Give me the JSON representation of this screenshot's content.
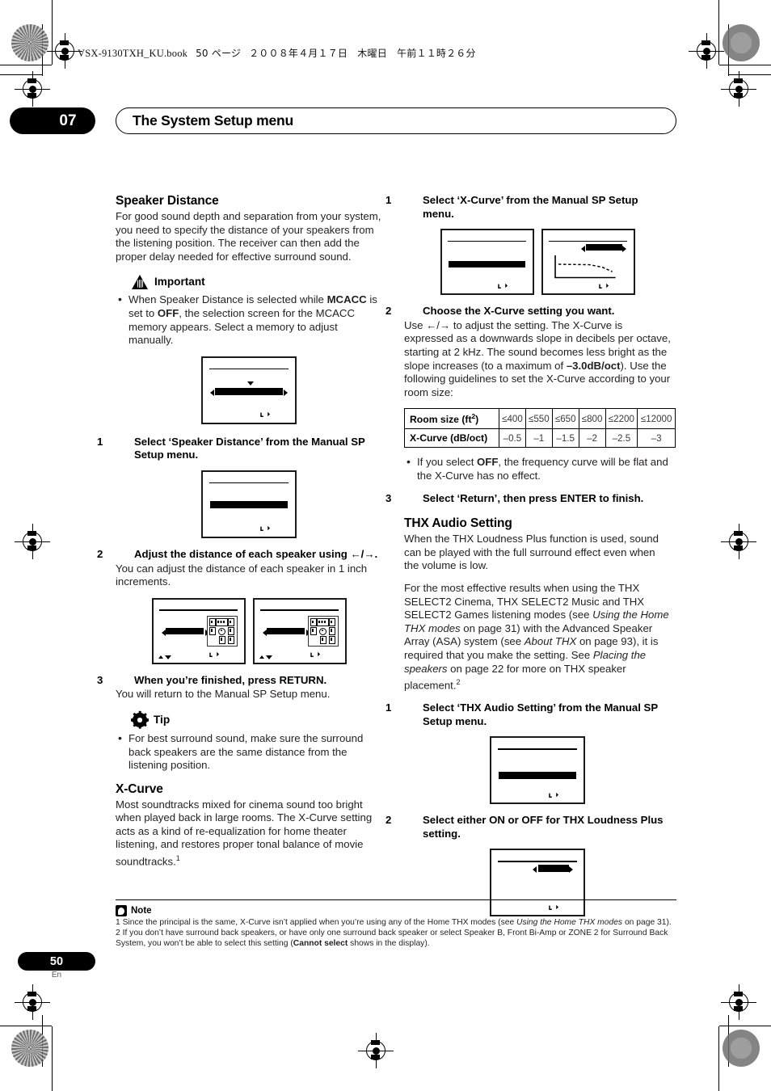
{
  "print_header": {
    "book_file": "VSX-9130TXH_KU.book",
    "page_marker": "50 ページ",
    "date": "２００８年４月１７日　木曜日　午前１１時２６分"
  },
  "chapter": {
    "number": "07",
    "title": "The System Setup menu"
  },
  "left_column": {
    "section1": {
      "heading": "Speaker Distance",
      "intro": "For good sound depth and separation from your system, you need to specify the distance of your speakers from the listening position. The receiver can then add the proper delay needed for effective surround sound.",
      "important_label": "Important",
      "important_bullet": "When Speaker Distance is selected while MCACC is set to OFF, the selection screen for the MCACC memory appears. Select a memory to adjust manually.",
      "step1_num": "1",
      "step1_text": "Select ‘Speaker Distance’ from the Manual SP Setup menu.",
      "step2_num": "2",
      "step2_text": "Adjust the distance of each speaker using ←/→.",
      "step2_body": "You can adjust the distance of each speaker in 1 inch increments.",
      "step3_num": "3",
      "step3_text": "When you’re finished, press RETURN.",
      "step3_body": "You will return to the Manual SP Setup menu.",
      "tip_label": "Tip",
      "tip_bullet": "For best surround sound, make sure the surround back speakers are the same distance from the listening position."
    },
    "section2": {
      "heading": "X-Curve",
      "body": "Most soundtracks mixed for cinema sound too bright when played back in large rooms. The X-Curve setting acts as a kind of re-equalization for home theater listening, and restores proper tonal balance of movie soundtracks.",
      "footnote_ref": "1"
    }
  },
  "right_column": {
    "xcurve_steps": {
      "step1_num": "1",
      "step1_text": "Select ‘X-Curve’ from the Manual SP Setup menu.",
      "step2_num": "2",
      "step2_text": "Choose the X-Curve setting you want.",
      "step2_body_a": "Use ←/→ to adjust the setting. The X-Curve is expressed as a downwards slope in decibels per octave, starting at 2 kHz. The sound becomes less bright as the slope increases (to a maximum of ",
      "step2_body_bold": "–3.0dB/oct",
      "step2_body_b": "). Use the following guidelines to set the X-Curve according to your room size:",
      "bullet_off": "If you select OFF, the frequency curve will be flat and the X-Curve has no effect.",
      "step3_num": "3",
      "step3_text": "Select ‘Return’, then press ENTER to finish."
    },
    "room_table": {
      "row_labels": [
        "Room size (ft2)",
        "X-Curve (dB/oct)"
      ],
      "room_sizes": [
        "≤400",
        "≤550",
        "≤650",
        "≤800",
        "≤2200",
        "≤12000"
      ],
      "xcurve_values": [
        "–0.5",
        "–1",
        "–1.5",
        "–2",
        "–2.5",
        "–3"
      ]
    },
    "thx": {
      "heading": "THX Audio Setting",
      "para1": "When the THX Loudness Plus function is used, sound can be played with the full surround effect even when the volume is low.",
      "para2_a": "For the most effective results when using the THX SELECT2 Cinema, THX SELECT2 Music and THX SELECT2 Games listening modes (see ",
      "para2_i1": "Using the Home THX modes",
      "para2_b": " on page 31) with the Advanced Speaker Array (ASA) system (see ",
      "para2_i2": "About THX",
      "para2_c": " on page 93), it is required that you make the setting. See ",
      "para2_i3": "Placing the speakers",
      "para2_d": " on page 22 for more on THX speaker placement.",
      "para2_ref": "2",
      "step1_num": "1",
      "step1_text": "Select ‘THX Audio Setting’ from the Manual SP Setup menu.",
      "step2_num": "2",
      "step2_text": "Select either ON or OFF for THX Loudness Plus setting."
    }
  },
  "notes": {
    "label": "Note",
    "note1_a": "1 Since the principal is the same, X-Curve isn’t applied when you’re using any of the Home THX modes (see ",
    "note1_i": "Using the Home THX modes",
    "note1_b": " on page 31).",
    "note2_a": "2 If you don’t have surround back speakers, or have only one surround back speaker or select Speaker B, Front Bi-Amp or ZONE 2 for Surround Back System, you won’t be able to select this setting (",
    "note2_bold": "Cannot select",
    "note2_b": " shows in the display)."
  },
  "footer": {
    "page_number": "50",
    "language": "En"
  }
}
